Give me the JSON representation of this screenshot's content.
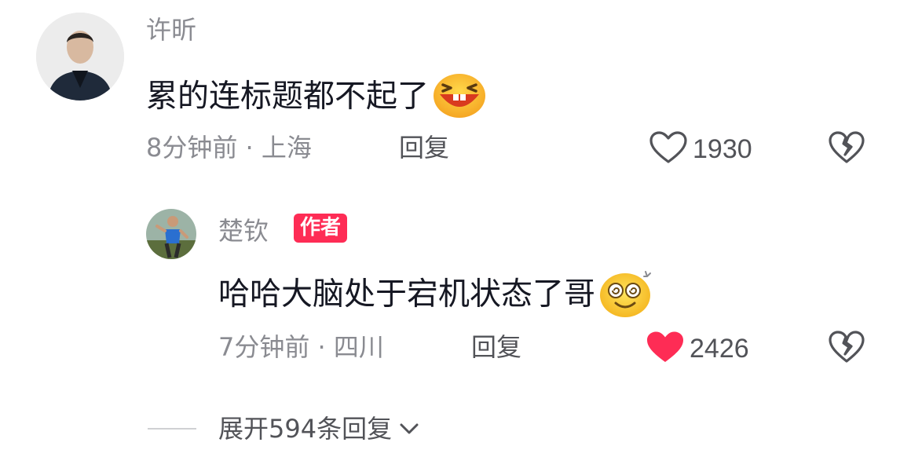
{
  "comments": [
    {
      "username": "许昕",
      "text": "累的连标题都不起了",
      "emoji_icon": "laughing-emoji",
      "meta": "8分钟前 · 上海",
      "reply_label": "回复",
      "likes": "1930",
      "liked": false
    }
  ],
  "reply": {
    "username": "楚钦",
    "badge": "作者",
    "text": "哈哈大脑处于宕机状态了哥",
    "emoji_icon": "dizzy-smile-emoji",
    "meta": "7分钟前 · 四川",
    "reply_label": "回复",
    "likes": "2426",
    "liked": true
  },
  "expand": {
    "label": "展开594条回复",
    "icon": "chevron-down-icon"
  },
  "colors": {
    "badge": "#fe2c55",
    "liked_heart": "#fe2c55",
    "muted_text": "#8a8b91",
    "action_text": "#525358"
  }
}
